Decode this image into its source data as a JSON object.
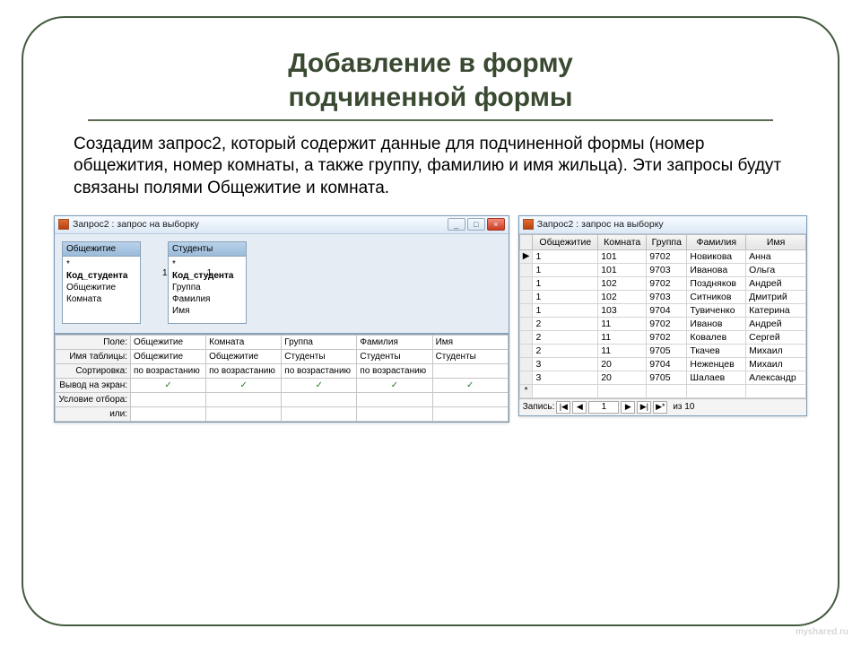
{
  "title_line1": "Добавление в форму",
  "title_line2": "подчиненной формы",
  "body_text": "Создадим запрос2, который содержит данные для подчиненной формы (номер общежития, номер комнаты, а также группу, фамилию и имя жильца). Эти запросы будут связаны полями Общежитие и комната.",
  "left_window": {
    "title": "Запрос2 : запрос на выборку",
    "btn_min": "_",
    "btn_max": "□",
    "btn_close": "×",
    "tables": {
      "t1": {
        "name": "Общежитие",
        "star": "*",
        "pk": "Код_студента",
        "f1": "Общежитие",
        "f2": "Комната"
      },
      "t2": {
        "name": "Студенты",
        "star": "*",
        "pk": "Код_студента",
        "f1": "Группа",
        "f2": "Фамилия",
        "f3": "Имя"
      }
    },
    "rel": {
      "a": "1",
      "b": "1"
    },
    "grid_rowlabels": {
      "field": "Поле:",
      "table": "Имя таблицы:",
      "sort": "Сортировка:",
      "show": "Вывод на экран:",
      "criteria": "Условие отбора:",
      "or": "или:"
    },
    "grid_cols": [
      {
        "field": "Общежитие",
        "table": "Общежитие",
        "sort": "по возрастанию",
        "show": "✓"
      },
      {
        "field": "Комната",
        "table": "Общежитие",
        "sort": "по возрастанию",
        "show": "✓"
      },
      {
        "field": "Группа",
        "table": "Студенты",
        "sort": "по возрастанию",
        "show": "✓"
      },
      {
        "field": "Фамилия",
        "table": "Студенты",
        "sort": "по возрастанию",
        "show": "✓"
      },
      {
        "field": "Имя",
        "table": "Студенты",
        "sort": "",
        "show": "✓"
      }
    ]
  },
  "right_window": {
    "title": "Запрос2 : запрос на выборку",
    "columns": [
      "Общежитие",
      "Комната",
      "Группа",
      "Фамилия",
      "Имя"
    ],
    "rows": [
      [
        "1",
        "101",
        "9702",
        "Новикова",
        "Анна"
      ],
      [
        "1",
        "101",
        "9703",
        "Иванова",
        "Ольга"
      ],
      [
        "1",
        "102",
        "9702",
        "Поздняков",
        "Андрей"
      ],
      [
        "1",
        "102",
        "9703",
        "Ситников",
        "Дмитрий"
      ],
      [
        "1",
        "103",
        "9704",
        "Тувиченко",
        "Катерина"
      ],
      [
        "2",
        "11",
        "9702",
        "Иванов",
        "Андрей"
      ],
      [
        "2",
        "11",
        "9702",
        "Ковалев",
        "Сергей"
      ],
      [
        "2",
        "11",
        "9705",
        "Ткачев",
        "Михаил"
      ],
      [
        "3",
        "20",
        "9704",
        "Неженцев",
        "Михаил"
      ],
      [
        "3",
        "20",
        "9705",
        "Шалаев",
        "Александр"
      ]
    ],
    "new_row_marker": "*",
    "nav": {
      "label": "Запись:",
      "first": "|◀",
      "prev": "◀",
      "current": "1",
      "next": "▶",
      "last": "▶|",
      "new": "▶*",
      "of": "из 10"
    }
  },
  "watermark": "myshared.ru"
}
